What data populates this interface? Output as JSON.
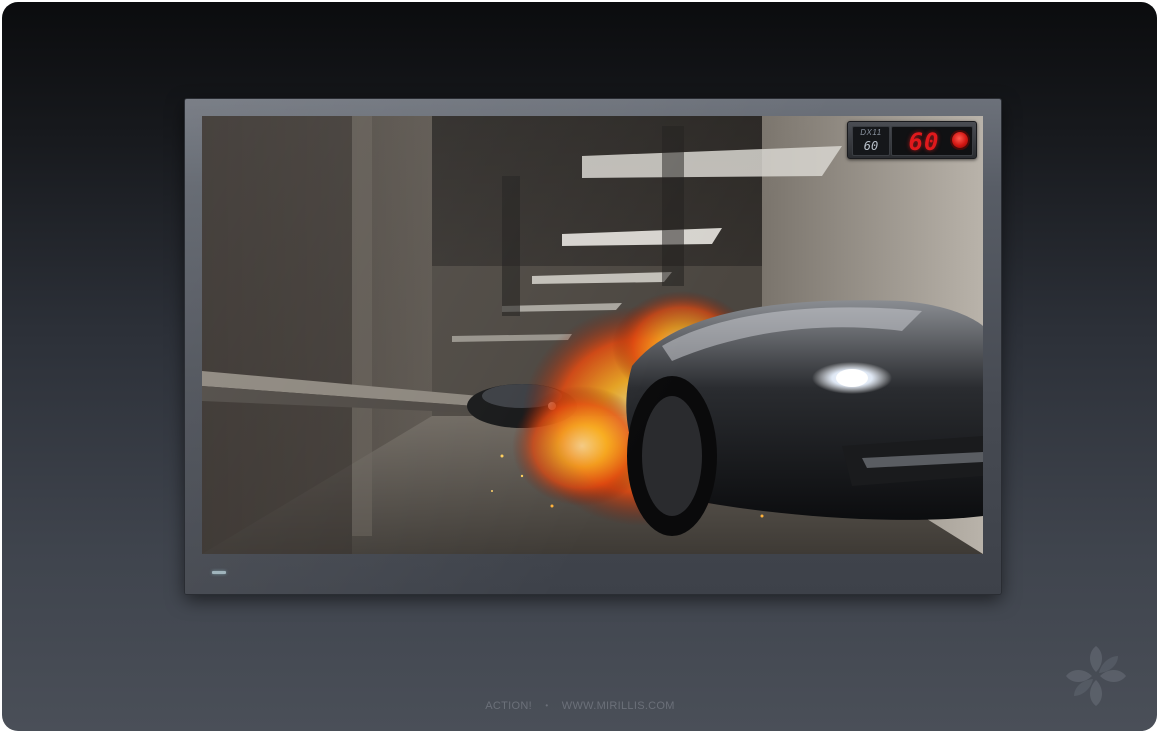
{
  "hud": {
    "api_label": "DX11",
    "api_fps": "60",
    "fps_value": "60",
    "recording": true
  },
  "footer": {
    "app_name": "ACTION!",
    "separator": "•",
    "website": "WWW.MIRILLIS.COM"
  },
  "colors": {
    "background_top": "#0b0c0e",
    "background_bottom": "#4a4f58",
    "monitor_bezel": "#585d66",
    "fps_red": "#e0191c",
    "record_red": "#d11612",
    "power_led": "#9ab0b8"
  },
  "icons": {
    "record": "record-dot-icon",
    "logo": "mirillis-flower-logo-icon"
  }
}
